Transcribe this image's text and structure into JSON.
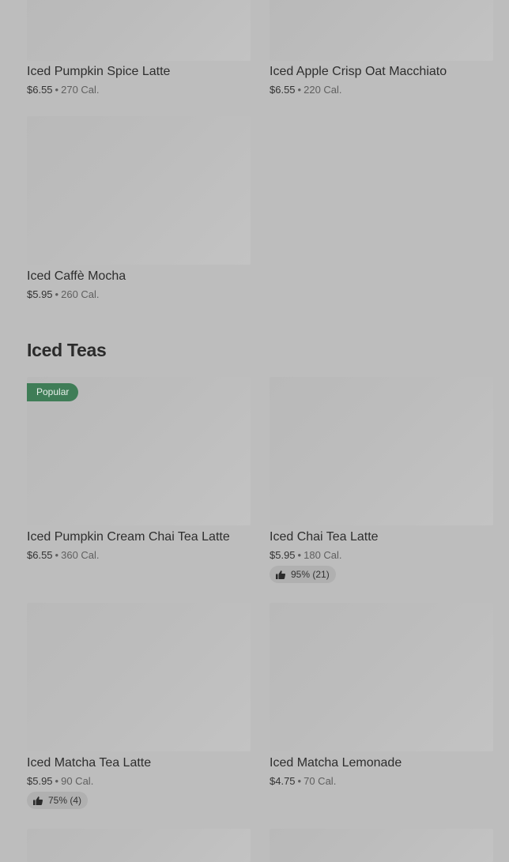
{
  "top_items": [
    {
      "name": "Iced Pumpkin Spice Latte",
      "price": "$6.55",
      "calories": "270 Cal."
    },
    {
      "name": "Iced Apple Crisp Oat Macchiato",
      "price": "$6.55",
      "calories": "220 Cal."
    },
    {
      "name": "Iced Caffè Mocha",
      "price": "$5.95",
      "calories": "260 Cal."
    }
  ],
  "separator": "•",
  "iced_teas": {
    "title": "Iced Teas",
    "items": [
      {
        "name": "Iced Pumpkin Cream Chai Tea Latte",
        "price": "$6.55",
        "calories": "360 Cal.",
        "badge": "Popular"
      },
      {
        "name": "Iced Chai Tea Latte",
        "price": "$5.95",
        "calories": "180 Cal.",
        "rating": "95% (21)"
      },
      {
        "name": "Iced Matcha Tea Latte",
        "price": "$5.95",
        "calories": "90 Cal.",
        "rating": "75% (4)"
      },
      {
        "name": "Iced Matcha Lemonade",
        "price": "$4.75",
        "calories": "70 Cal."
      }
    ]
  },
  "colors": {
    "background": "#bdbdbd",
    "badge": "#3f7d57",
    "rating_pill": "#b0b0b0"
  }
}
